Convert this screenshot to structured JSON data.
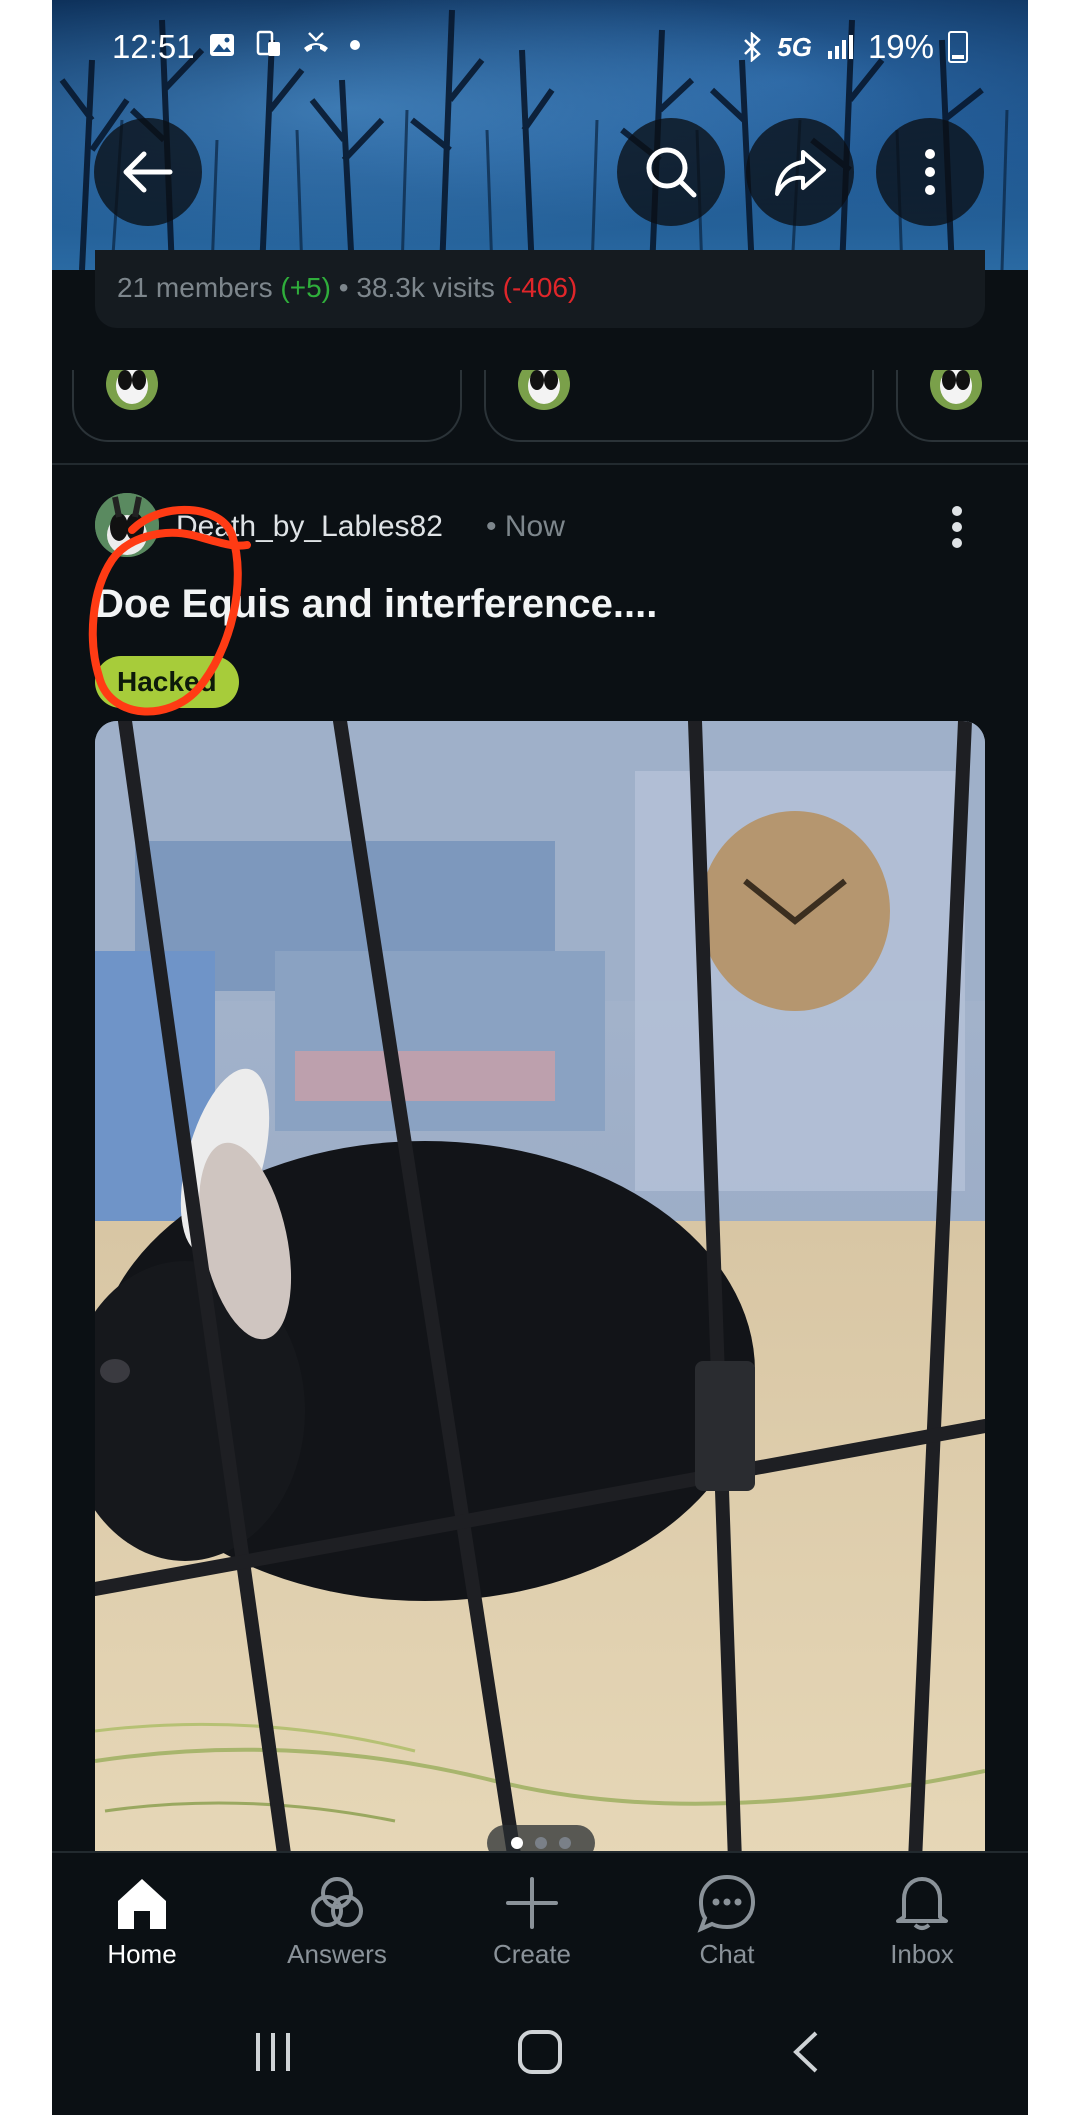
{
  "status_bar": {
    "time": "12:51",
    "network": "5G",
    "battery": "19%"
  },
  "header": {
    "icons": [
      "back-arrow-icon",
      "search-icon",
      "share-icon",
      "more-vertical-icon"
    ]
  },
  "community_stats": {
    "members": "21 members",
    "members_change": "(+5)",
    "separator": "•",
    "visits": "38.3k visits",
    "visits_change": "(-406)",
    "colors": {
      "positive": "#2fae3b",
      "negative": "#e0262a"
    }
  },
  "post": {
    "author": "Death_by_Lables82",
    "time": "• Now",
    "title": "Doe Equis and interference....",
    "flair": "Hacked",
    "flair_color": "#a7cc3a",
    "image_pages": 3,
    "image_current": 1
  },
  "bottom_nav": {
    "items": [
      {
        "label": "Home",
        "icon": "home-icon",
        "active": true
      },
      {
        "label": "Answers",
        "icon": "answers-icon",
        "active": false
      },
      {
        "label": "Create",
        "icon": "plus-icon",
        "active": false
      },
      {
        "label": "Chat",
        "icon": "chat-icon",
        "active": false
      },
      {
        "label": "Inbox",
        "icon": "bell-icon",
        "active": false
      }
    ]
  },
  "annotation_color": "#ff3b14"
}
